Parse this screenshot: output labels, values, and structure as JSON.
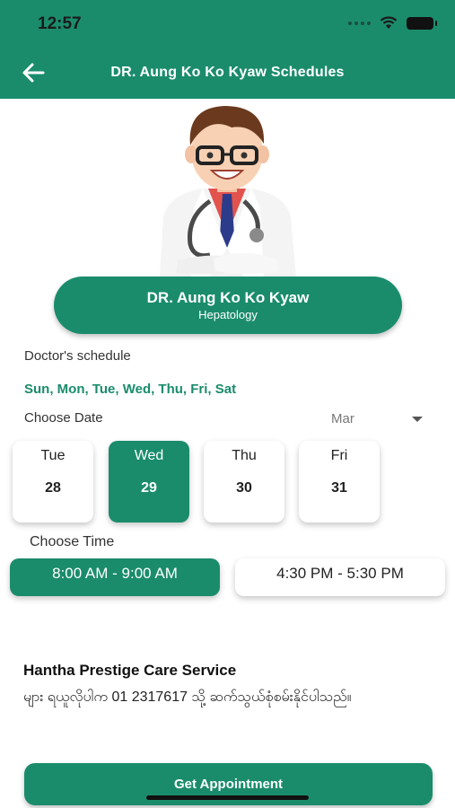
{
  "status_bar": {
    "time": "12:57"
  },
  "header": {
    "title": "DR. Aung Ko Ko Kyaw Schedules",
    "back_icon": "arrow-left-icon"
  },
  "doctor": {
    "name": "DR. Aung Ko Ko Kyaw",
    "specialty": "Hepatology"
  },
  "schedule": {
    "label": "Doctor's schedule",
    "days": "Sun, Mon, Tue, Wed, Thu, Fri, Sat"
  },
  "date_picker": {
    "label": "Choose Date",
    "month": "Mar",
    "dates": [
      {
        "day": "Tue",
        "num": "28",
        "selected": false
      },
      {
        "day": "Wed",
        "num": "29",
        "selected": true
      },
      {
        "day": "Thu",
        "num": "30",
        "selected": false
      },
      {
        "day": "Fri",
        "num": "31",
        "selected": false
      }
    ]
  },
  "time_picker": {
    "label": "Choose Time",
    "slots": [
      {
        "label": "8:00 AM - 9:00 AM",
        "selected": true
      },
      {
        "label": "4:30 PM - 5:30 PM",
        "selected": false
      }
    ]
  },
  "provider": {
    "name": "Hantha Prestige Care Service",
    "note": "များ ရယူလိုပါက 01 2317617 သို့ ဆက်သွယ်စုံစမ်းနိုင်ပါသည်။"
  },
  "cta": {
    "label": "Get Appointment"
  },
  "colors": {
    "primary": "#1a8c6c",
    "white": "#ffffff"
  }
}
